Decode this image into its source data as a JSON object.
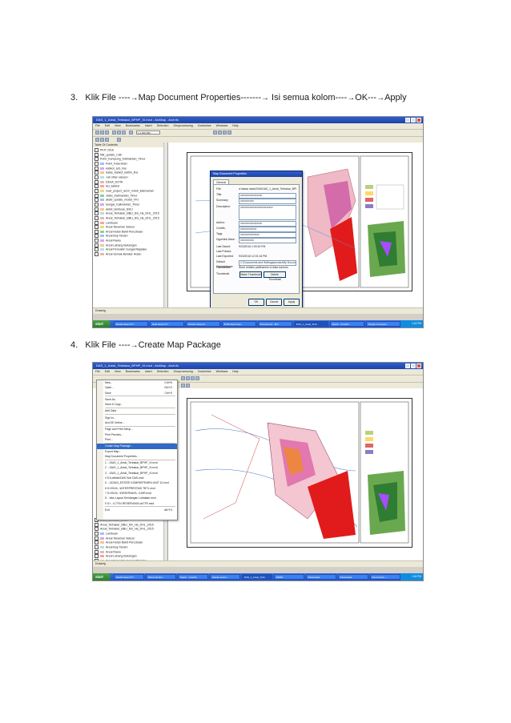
{
  "steps": [
    {
      "number": "3.",
      "text_a": "Klik File ----",
      "arrow": "→",
      "text_b": "Map Document Properties-------",
      "text_c": " Isi semua kolom----",
      "text_d": "OK---",
      "text_e": "Apply"
    },
    {
      "number": "4.",
      "text_a": "Klik File ----",
      "arrow": "→",
      "text_b": "Create Map Package"
    }
  ],
  "shot1": {
    "window_title": "DAS_1_Areal_Terbakar_BPHP_XI.mxd - ArcMap - ArcInfo",
    "menus": [
      "File",
      "Edit",
      "View",
      "Bookmarks",
      "Insert",
      "Selection",
      "Geoprocessing",
      "Customize",
      "Windows",
      "Help"
    ],
    "scale": "1:1.000.000",
    "toc_title": "Table Of Contents",
    "toc_items": [
      "PKIT 2016",
      "titik_update_rutin",
      "Point_Kampung_Kalimantan_Timur",
      "Point_Kelurahan",
      "kabkot_sub_line",
      "batas_kabkot_kaltim_line",
      "<all other values>",
      "DESA_KOTA",
      "kel_kabkot",
      "road_project_arcm_mdnk_kalimantan",
      "Jalan_Kalimantan_Timur",
      "aksid_update_model_FKI",
      "Sungai_Kalimantan_Timur",
      "aksid_lambuan_BKLI",
      "Areal_Terbakar_BBLI_BS_Ha_DHL_2015",
      "Areal_Terbakar_BBLI_BS_Ha_DHL_2015",
      "Lambuan",
      "Areal Tanaman Sekcer",
      "Areal Hutan Bekit Percobaan",
      "Areal Bup Tanam",
      "Areal Rawa",
      "Areal Lahang Bekangan",
      "Areal Pemukim Sungai Rijasake",
      "Areal Semak Belukar Hutan"
    ],
    "status": "Drawing",
    "dialog": {
      "title": "Map Document Properties",
      "tab": "General",
      "file_label": "File:",
      "file_value": "d:\\dasar data\\2016\\DAS_1_Areal_Terbakar_BPHP_XI.mxd",
      "title_label": "Title:",
      "title_value": "xxxxxxxxxxxxxxxx",
      "summary_label": "Summary:",
      "summary_value": "xxxxxxxxxx",
      "description_label": "Description:",
      "description_value": "xxxxxxxxxxxxxxxxxxxxxxxx",
      "author_label": "Author:",
      "author_value": "xxxxxxxxxxxxxxxx",
      "credits_label": "Credits:",
      "credits_value": "xxxxxxxxxxxx",
      "tags_label": "Tags:",
      "tags_value": "xxxxxxxxxxxxxx",
      "hyperlink_label": "Hyperlink Base:",
      "hyperlink_value": "xxxxxxxxxx",
      "last_saved_label": "Last Saved:",
      "last_saved_value": "9/23/2016 1:00:40 PM",
      "last_printed_label": "Last Printed:",
      "last_printed_value": "",
      "last_exported_label": "Last Exported:",
      "last_exported_value": "9/24/2016 12:01:16 PM",
      "default_gdb_label": "Default Geodatabase:",
      "default_gdb_value": "C:\\Documents and Settings\\pmoko\\My Docume",
      "pathnames_label": "Pathnames:",
      "pathnames_value": "Store relative pathnames to data sources",
      "thumbnail_label": "Thumbnail:",
      "make_thumbnail": "Make Thumbnail",
      "delete_thumbnail": "Delete Thumbnail",
      "ok": "OK",
      "cancel": "Cancel",
      "apply": "Apply"
    },
    "taskbar": {
      "start": "start",
      "tasks": [
        "Media Search P...",
        "Data Search P...",
        "Mobile Network...",
        "B Windows Exp...",
        "Document1 - Mic...",
        "DAS_1_Areal_Terb...",
        "Spark - smartfo...",
        "Simple Computer..."
      ],
      "clock": "1:15 PM"
    }
  },
  "shot2": {
    "window_title": "DAS_1_Areal_Terbakar_BPHP_XI.mxd - ArcMap - ArcInfo",
    "menus": [
      "File",
      "Edit",
      "View",
      "Bookmarks",
      "Insert",
      "Selection",
      "Geoprocessing",
      "Customize",
      "Windows",
      "Help"
    ],
    "file_menu": [
      {
        "label": "New...",
        "shortcut": "Ctrl+N"
      },
      {
        "label": "Open...",
        "shortcut": "Ctrl+O"
      },
      {
        "label": "Save",
        "shortcut": "Ctrl+S"
      },
      {
        "label": "Save As...",
        "shortcut": ""
      },
      {
        "label": "Save A Copy...",
        "shortcut": ""
      },
      {
        "label": "Add Data",
        "shortcut": ""
      },
      {
        "label": "Sign In...",
        "shortcut": ""
      },
      {
        "label": "ArcGIS Online...",
        "shortcut": ""
      },
      {
        "label": "Page and Print Setup...",
        "shortcut": ""
      },
      {
        "label": "Print Preview...",
        "shortcut": ""
      },
      {
        "label": "Print...",
        "shortcut": ""
      },
      {
        "label": "Create Map Package...",
        "shortcut": ""
      },
      {
        "label": "Export Map...",
        "shortcut": ""
      },
      {
        "label": "Map Document Properties...",
        "shortcut": ""
      },
      {
        "label": "1 ...\\DAS_1_Areal_Terbakar_BPHP_XI.mxd",
        "shortcut": ""
      },
      {
        "label": "2 ...\\DAS_1_Areal_Terbakar_BPHP_XI.mxd",
        "shortcut": ""
      },
      {
        "label": "3 ...\\DAS_1_Areal_Terbakar_BPHP_XI.mxd",
        "shortcut": ""
      },
      {
        "label": "4 D:\\Latihan\\DAS Sub DAS.mxd",
        "shortcut": ""
      },
      {
        "label": "5 ...\\2016\\3_ESTATE KOMPARTEMEN UNIT 12.mxd",
        "shortcut": ""
      },
      {
        "label": "6 D:\\2016\\...\\INTERPRESTASI TBT1.mxd",
        "shortcut": ""
      },
      {
        "label": "7 D:\\2016\\...\\RESERVASI\\...\\UHR.mxd",
        "shortcut": ""
      },
      {
        "label": "8 ...\\eks Layout Kendangan Lokbatan.mxd",
        "shortcut": ""
      },
      {
        "label": "9 D:\\...\\L7TE4 RESERVASI\\Lok7TR.mxd",
        "shortcut": ""
      },
      {
        "label": "Exit",
        "shortcut": "Alt+F4"
      }
    ],
    "toc_items": [
      "aksid_lambuan_BKLI",
      "Areal_Terbakar_BBLI_BS_Ha_DHL_2015",
      "Areal_Terbakar_BBLI_BS_Ha_DHL_2015",
      "Lambuan",
      "Areal Tanaman Sekcer",
      "Areal Hutan Bekit Percobaan",
      "Areal Bup Tanam",
      "Areal Rawa",
      "Areal Lahang Bekangan",
      "Areal Pemukim Sungai Rijasake",
      "Areal Semak Belukar Hutan"
    ],
    "status": "Drawing",
    "taskbar": {
      "start": "start",
      "tasks": [
        "Media Search P...",
        "Microsoft Exc...",
        "Spark - smartfo...",
        "Aloebe lowon...",
        "DAS_1_Areal_Terb...",
        "DDDD",
        "Downloads",
        "Downloads",
        "Document1 - ..."
      ],
      "clock": "1:18 PM"
    }
  }
}
